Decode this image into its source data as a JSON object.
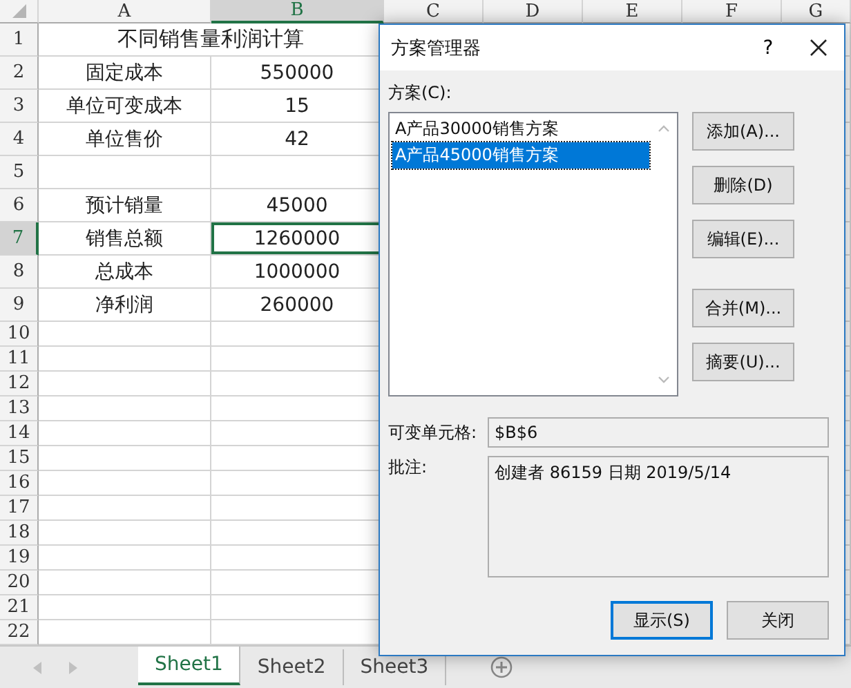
{
  "spreadsheet": {
    "columns": [
      {
        "label": "A",
        "selected": false
      },
      {
        "label": "B",
        "selected": true
      },
      {
        "label": "C",
        "selected": false
      },
      {
        "label": "D",
        "selected": false
      },
      {
        "label": "E",
        "selected": false
      },
      {
        "label": "F",
        "selected": false
      },
      {
        "label": "G",
        "selected": false
      }
    ],
    "rows": [
      {
        "number": "1",
        "kind": "title",
        "selected": false,
        "title": "不同销售量利润计算"
      },
      {
        "number": "2",
        "kind": "data",
        "selected": false,
        "cells": [
          {
            "text": "固定成本",
            "active": false
          },
          {
            "text": "550000",
            "active": false
          }
        ]
      },
      {
        "number": "3",
        "kind": "data",
        "selected": false,
        "cells": [
          {
            "text": "单位可变成本",
            "active": false
          },
          {
            "text": "15",
            "active": false
          }
        ]
      },
      {
        "number": "4",
        "kind": "data",
        "selected": false,
        "cells": [
          {
            "text": "单位售价",
            "active": false
          },
          {
            "text": "42",
            "active": false
          }
        ]
      },
      {
        "number": "5",
        "kind": "data",
        "selected": false
      },
      {
        "number": "6",
        "kind": "data",
        "selected": false,
        "cells": [
          {
            "text": "预计销量",
            "active": false
          },
          {
            "text": "45000",
            "active": false
          }
        ]
      },
      {
        "number": "7",
        "kind": "data",
        "selected": true,
        "cells": [
          {
            "text": "销售总额",
            "active": false
          },
          {
            "text": "1260000",
            "active": true
          }
        ]
      },
      {
        "number": "8",
        "kind": "data",
        "selected": false,
        "cells": [
          {
            "text": "总成本",
            "active": false
          },
          {
            "text": "1000000",
            "active": false
          }
        ]
      },
      {
        "number": "9",
        "kind": "data",
        "selected": false,
        "cells": [
          {
            "text": "净利润",
            "active": false
          },
          {
            "text": "260000",
            "active": false
          }
        ]
      },
      {
        "number": "10",
        "kind": "blank",
        "selected": false
      },
      {
        "number": "11",
        "kind": "blank",
        "selected": false
      },
      {
        "number": "12",
        "kind": "blank",
        "selected": false
      },
      {
        "number": "13",
        "kind": "blank",
        "selected": false
      },
      {
        "number": "14",
        "kind": "blank",
        "selected": false
      },
      {
        "number": "15",
        "kind": "blank",
        "selected": false
      },
      {
        "number": "16",
        "kind": "blank",
        "selected": false
      },
      {
        "number": "17",
        "kind": "blank",
        "selected": false
      },
      {
        "number": "18",
        "kind": "blank",
        "selected": false
      },
      {
        "number": "19",
        "kind": "blank",
        "selected": false
      },
      {
        "number": "20",
        "kind": "blank",
        "selected": false
      },
      {
        "number": "21",
        "kind": "blank",
        "selected": false
      },
      {
        "number": "22",
        "kind": "blank",
        "selected": false
      }
    ]
  },
  "sheet_tabs": [
    {
      "label": "Sheet1",
      "selected": true
    },
    {
      "label": "Sheet2",
      "selected": false
    },
    {
      "label": "Sheet3",
      "selected": false
    }
  ],
  "dialog": {
    "title": "方案管理器",
    "help": "?",
    "scenarios_label": "方案(C):",
    "scenarios": [
      {
        "label": "A产品30000销售方案",
        "selected": false
      },
      {
        "label": "A产品45000销售方案",
        "selected": true
      }
    ],
    "side_button_groups": [
      [
        "添加(A)...",
        "删除(D)",
        "编辑(E)..."
      ],
      [
        "合并(M)...",
        "摘要(U)..."
      ]
    ],
    "changing_cells_label": "可变单元格:",
    "changing_cells": "$B$6",
    "comment_label": "批注:",
    "comment": "创建者 86159 日期 2019/5/14",
    "buttons": [
      {
        "label": "显示(S)",
        "default": true
      },
      {
        "label": "关闭",
        "default": false
      }
    ]
  }
}
